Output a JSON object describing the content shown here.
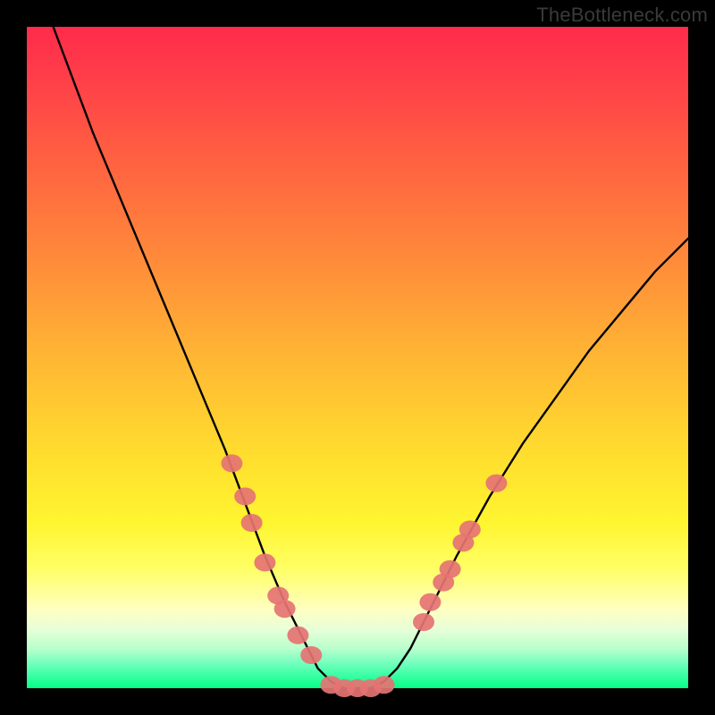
{
  "watermark": {
    "text": "TheBottleneck.com"
  },
  "chart_data": {
    "type": "line",
    "title": "",
    "xlabel": "",
    "ylabel": "",
    "xlim": [
      0,
      100
    ],
    "ylim": [
      0,
      100
    ],
    "series": [
      {
        "name": "bottleneck-curve",
        "x": [
          4,
          10,
          15,
          20,
          25,
          30,
          33,
          36,
          39,
          42,
          44,
          46,
          48,
          50,
          52,
          54,
          56,
          58,
          60,
          65,
          70,
          75,
          80,
          85,
          90,
          95,
          100
        ],
        "values": [
          100,
          84,
          72,
          60,
          48,
          36,
          28,
          20,
          13,
          7,
          3,
          1,
          0,
          0,
          0,
          1,
          3,
          6,
          10,
          20,
          29,
          37,
          44,
          51,
          57,
          63,
          68
        ]
      }
    ],
    "markers": {
      "name": "highlight-dots",
      "color": "#e57373",
      "radius_px": 10,
      "points": [
        {
          "x": 31,
          "y": 34
        },
        {
          "x": 33,
          "y": 29
        },
        {
          "x": 34,
          "y": 25
        },
        {
          "x": 36,
          "y": 19
        },
        {
          "x": 38,
          "y": 14
        },
        {
          "x": 39,
          "y": 12
        },
        {
          "x": 41,
          "y": 8
        },
        {
          "x": 43,
          "y": 5
        },
        {
          "x": 46,
          "y": 0.5
        },
        {
          "x": 48,
          "y": 0
        },
        {
          "x": 50,
          "y": 0
        },
        {
          "x": 52,
          "y": 0
        },
        {
          "x": 54,
          "y": 0.5
        },
        {
          "x": 60,
          "y": 10
        },
        {
          "x": 61,
          "y": 13
        },
        {
          "x": 63,
          "y": 16
        },
        {
          "x": 64,
          "y": 18
        },
        {
          "x": 66,
          "y": 22
        },
        {
          "x": 67,
          "y": 24
        },
        {
          "x": 71,
          "y": 31
        }
      ]
    }
  }
}
